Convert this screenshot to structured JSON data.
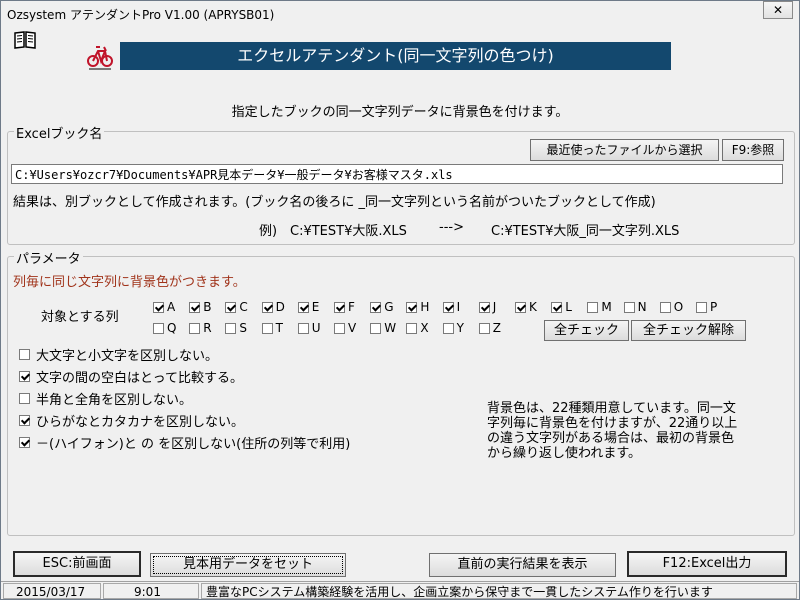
{
  "window": {
    "title": "Ozsystem アテンダントPro V1.00 (APRYSB01)",
    "close_label": "✕"
  },
  "header": {
    "book_icon": "book-icon",
    "bike_icon": "bicycle-icon",
    "banner_title": "エクセルアテンダント(同一文字列の色つけ)"
  },
  "instruction": "指定したブックの同一文字列データに背景色を付けます。",
  "excel_group": {
    "label": "Excelブック名",
    "recent_button": "最近使ったファイルから選択",
    "browse_button": "F9:参照",
    "file_path": "C:¥Users¥ozcr7¥Documents¥APR見本データ¥一般データ¥お客様マスタ.xls",
    "result_note": "結果は、別ブックとして作成されます。(ブック名の後ろに _同一文字列という名前がついたブックとして作成)",
    "example_label": "例)",
    "example_src": "C:¥TEST¥大阪.XLS",
    "example_arrow": "--->",
    "example_dst": "C:¥TEST¥大阪_同一文字列.XLS"
  },
  "params_group": {
    "label": "パラメータ",
    "red_note": "列毎に同じ文字列に背景色がつきます。",
    "target_label": "対象とする列",
    "columns": [
      {
        "letter": "A",
        "checked": true
      },
      {
        "letter": "B",
        "checked": true
      },
      {
        "letter": "C",
        "checked": true
      },
      {
        "letter": "D",
        "checked": true
      },
      {
        "letter": "E",
        "checked": true
      },
      {
        "letter": "F",
        "checked": true
      },
      {
        "letter": "G",
        "checked": true
      },
      {
        "letter": "H",
        "checked": true
      },
      {
        "letter": "I",
        "checked": true
      },
      {
        "letter": "J",
        "checked": true
      },
      {
        "letter": "K",
        "checked": true
      },
      {
        "letter": "L",
        "checked": true
      },
      {
        "letter": "M",
        "checked": false
      },
      {
        "letter": "N",
        "checked": false
      },
      {
        "letter": "O",
        "checked": false
      },
      {
        "letter": "P",
        "checked": false
      },
      {
        "letter": "Q",
        "checked": false
      },
      {
        "letter": "R",
        "checked": false
      },
      {
        "letter": "S",
        "checked": false
      },
      {
        "letter": "T",
        "checked": false
      },
      {
        "letter": "U",
        "checked": false
      },
      {
        "letter": "V",
        "checked": false
      },
      {
        "letter": "W",
        "checked": false
      },
      {
        "letter": "X",
        "checked": false
      },
      {
        "letter": "Y",
        "checked": false
      },
      {
        "letter": "Z",
        "checked": false
      }
    ],
    "check_all_button": "全チェック",
    "uncheck_all_button": "全チェック解除",
    "options": [
      {
        "label": "大文字と小文字を区別しない。",
        "checked": false
      },
      {
        "label": "文字の間の空白はとって比較する。",
        "checked": true
      },
      {
        "label": "半角と全角を区別しない。",
        "checked": false
      },
      {
        "label": "ひらがなとカタカナを区別しない。",
        "checked": true
      },
      {
        "label": "－(ハイフォン)と の を区別しない(住所の列等で利用)",
        "checked": true
      }
    ],
    "bg_note_lines": [
      "背景色は、22種類用意しています。同一文",
      "字列毎に背景色を付けますが、22通り以上",
      "の違う文字列がある場合は、最初の背景色",
      "から繰り返し使われます。"
    ]
  },
  "footer_buttons": {
    "esc": "ESC:前画面",
    "sample": "見本用データをセット",
    "last_result": "直前の実行結果を表示",
    "f12": "F12:Excel出力"
  },
  "statusbar": {
    "date": "2015/03/17",
    "time": "9:01",
    "message": "豊富なPCシステム構築経験を活用し、企画立案から保守まで一貫したシステム作りを行います"
  },
  "colors": {
    "banner_bg": "#13486e",
    "red_note": "#a0331a",
    "bike": "#c0142a"
  }
}
